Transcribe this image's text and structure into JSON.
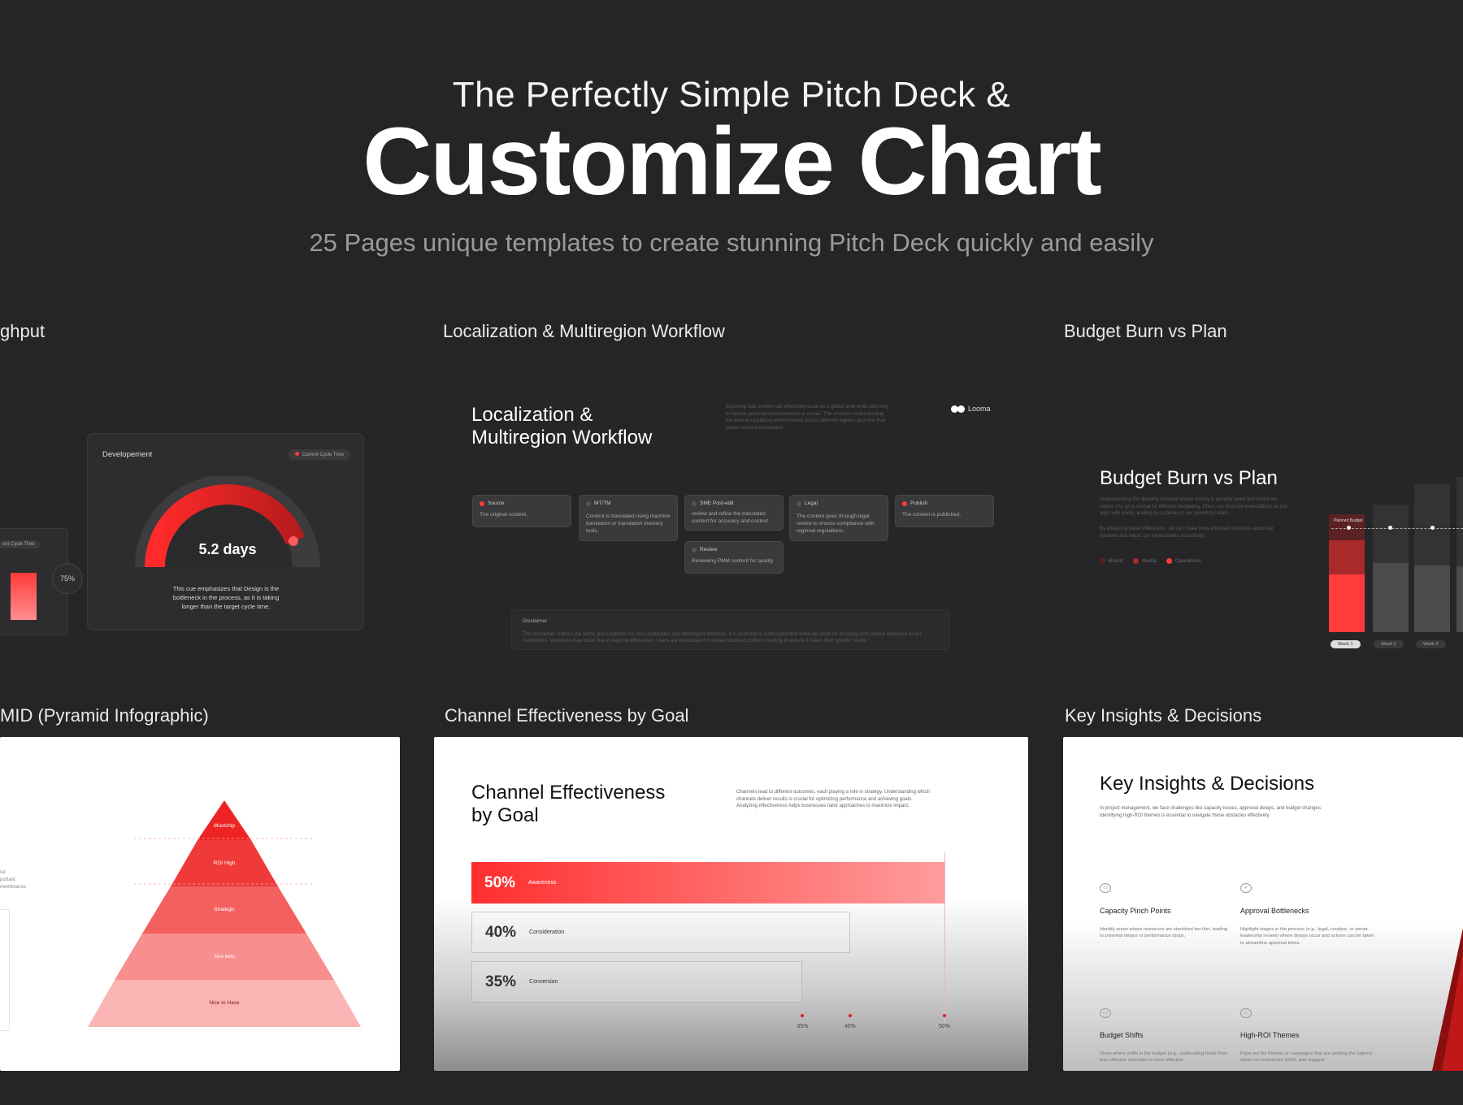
{
  "hero": {
    "subtitle": "The Perfectly Simple Pitch Deck &",
    "title": "Customize Chart",
    "tagline": "25 Pages unique templates to create stunning Pitch Deck quickly and easily"
  },
  "sections": {
    "throughput": "ghput",
    "localization": "Localization & Multiregion Workflow",
    "budget": "Budget Burn vs Plan",
    "pyramid": "MID (Pyramid Infographic)",
    "channel": "Channel Effectiveness by Goal",
    "insights": "Key Insights & Decisions"
  },
  "throughput_card": {
    "panel_title": "Developement",
    "badge": "Current Cycle Time",
    "gauge_value": "5.2 days",
    "gauge_level": 0.88,
    "note": "This cue emphasizes that Design is the bottleneck in the process, as it is taking longer than the target cycle time.",
    "left_badge": "ent Cycle Time",
    "left_percent": "75%"
  },
  "localization_card": {
    "title_line1": "Localization &",
    "title_line2": "Multiregion Workflow",
    "description": "Exploring how content can effectively scale on a global level while adhering to various governance frameworks is crucial. This involves understanding the diverse regulatory environments across different regions and how they impact content distribution.",
    "brand": "Looma",
    "steps": [
      {
        "name": "Source",
        "body": "The original content."
      },
      {
        "name": "MT/TM",
        "body": "Content is translated using machine translation or translation memory tools."
      },
      {
        "name": "SME Post-edit",
        "body": "review and refine the translated content for accuracy and context."
      },
      {
        "name": "Legal",
        "body": "The content goes through legal review to ensure compliance with regional regulations."
      },
      {
        "name": "Publish",
        "body": "The content is published."
      }
    ],
    "review": {
      "name": "Review",
      "body": "Reviewing PMM content for quality."
    },
    "disclaimer_title": "Disclaimer",
    "disclaimer_body": "This disclaimer outlines the terms and conditions for our Localization and Multiregion Workflow. It is essential to understand that while we strive for accuracy and cultural relevance in our translations, variations may occur due to regional differences. Users are encouraged to review localized content carefully to ensure it meets their specific needs."
  },
  "budget_card": {
    "title": "Budget Burn vs Plan",
    "para1": "Understanding the disparity between where money is actually spent and where we expect it to go is crucial for effective budgeting. Often, our financial expectations do not align with reality, leading to surprises in our spending habits.",
    "para2": "By analyzing these differences, we can make more informed decisions about our finances and adjust our expectations accordingly.",
    "legend": [
      "Brand",
      "Media",
      "Operations"
    ],
    "legend_colors": [
      "#5a2020",
      "#a82a2a",
      "#ff3b3b"
    ],
    "planned_label": "Planned Budget",
    "weeks": [
      "Week 1",
      "Week 2",
      "Week 3"
    ]
  },
  "pyramid_card": {
    "levels": [
      "Mustship",
      "ROI High",
      "Strategic",
      "Test bets",
      "Nice to Have"
    ],
    "level_colors": [
      "#ee2424",
      "#f03a3a",
      "#f46060",
      "#f88e8e",
      "#fbb5b5"
    ],
    "left_text": [
      "ral",
      "portant",
      "membrance."
    ]
  },
  "channel_card": {
    "title_line1": "Channel Effectiveness",
    "title_line2": "by Goal",
    "description": "Channels lead to different outcomes, each playing a role in strategy. Understanding which channels deliver results is crucial for optimizing performance and achieving goals. Analyzing effectiveness helps businesses tailor approaches to maximize impact.",
    "chart_data": {
      "type": "bar",
      "orientation": "horizontal",
      "categories": [
        "Awareness",
        "Consideration",
        "Conversion"
      ],
      "values": [
        50,
        40,
        35
      ],
      "value_labels": [
        "50%",
        "40%",
        "35%"
      ],
      "x_ticks": [
        "35%",
        "40%",
        "50%"
      ],
      "xlim": [
        0,
        50
      ]
    }
  },
  "insights_card": {
    "title": "Key Insights & Decisions",
    "intro": "In project management, we face challenges like capacity issues, approval delays, and budget changes. Identifying high-ROI themes is essential to navigate these obstacles effectively.",
    "items": [
      {
        "title": "Capacity Pinch Points",
        "body": "Identify areas where resources are stretched too thin, leading to potential delays or performance drops."
      },
      {
        "title": "Approval Bottlenecks",
        "body": "Highlight stages in the process (e.g., legal, creative, or senior leadership review) where delays occur and actions can be taken to streamline approval times."
      },
      {
        "title": "Budget Shifts",
        "body": "Show where shifts in the budget (e.g., reallocating funds from less effective channels to more effective"
      },
      {
        "title": "High-ROI Themes",
        "body": "Point out the themes or campaigns that are yielding the highest return on investment (ROI), and suggest"
      }
    ]
  }
}
